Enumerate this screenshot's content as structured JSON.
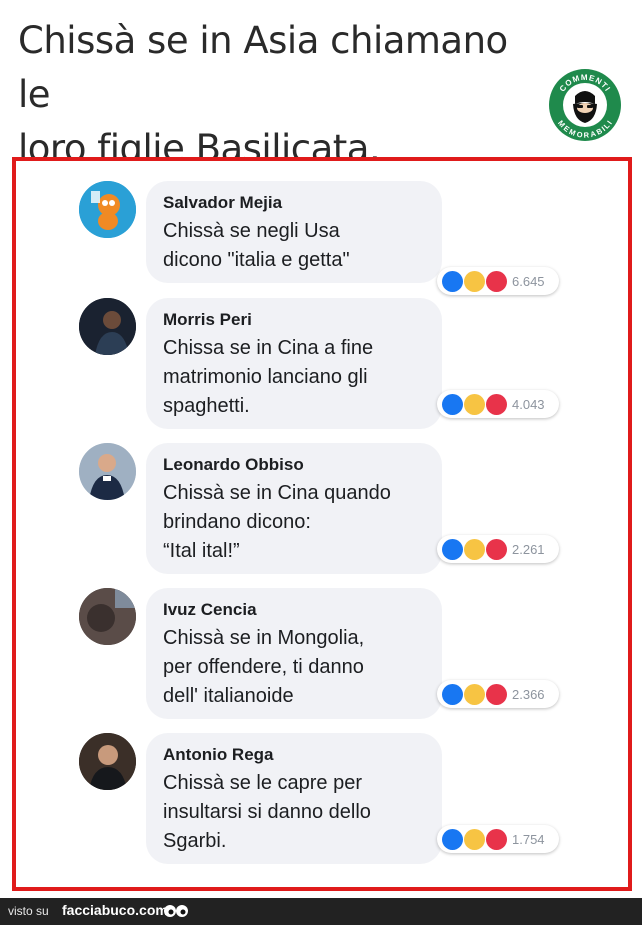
{
  "headline": {
    "line1": "Chissà se in Asia chiamano le",
    "line2": "loro figlie Basilicata."
  },
  "badge": {
    "top_text": "COMMENTI",
    "bottom_text": "MEMORABILI"
  },
  "comments": [
    {
      "author": "Salvador Mejia",
      "text": "Chissà se negli Usa\ndicono \"italia e getta\"",
      "count": "6.645"
    },
    {
      "author": "Morris Peri",
      "text": "Chissa se in Cina a fine\nmatrimonio lanciano gli\nspaghetti.",
      "count": "4.043"
    },
    {
      "author": "Leonardo Obbiso",
      "text": "Chissà se in Cina quando\nbrindano dicono:\n“Ital ital!”",
      "count": "2.261"
    },
    {
      "author": "Ivuz Cencia",
      "text": "Chissà se in Mongolia,\nper offendere, ti danno\ndell' italianoide",
      "count": "2.366"
    },
    {
      "author": "Antonio Rega",
      "text": "Chissà se le capre per\ninsultarsi si danno dello\nSgarbi.",
      "count": "1.754"
    }
  ],
  "footer": {
    "visto_su": "visto su",
    "site": "facciabuco.com"
  },
  "colors": {
    "frame": "#e01b1b",
    "bubble": "#f1f2f6",
    "like": "#1877f2",
    "haha": "#f7c443",
    "love": "#e8334a",
    "badge_green": "#1f8a4c"
  }
}
